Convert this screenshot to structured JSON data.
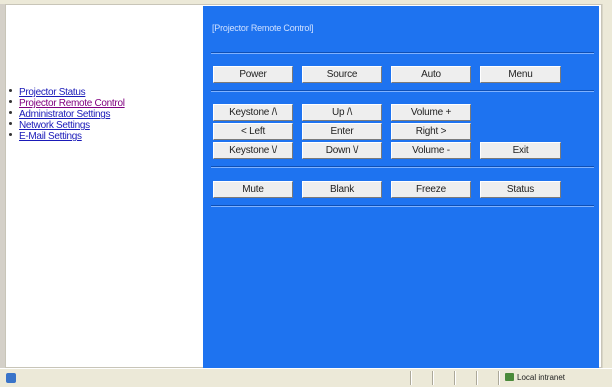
{
  "nav": {
    "items": [
      {
        "label": "Projector Status"
      },
      {
        "label": "Projector Remote Control"
      },
      {
        "label": "Administrator Settings"
      },
      {
        "label": "Network Settings"
      },
      {
        "label": "E-Mail Settings"
      }
    ]
  },
  "content": {
    "title": "[Projector Remote Control]",
    "buttons": {
      "power": "Power",
      "source": "Source",
      "auto": "Auto",
      "menu": "Menu",
      "keystone_up": "Keystone /\\",
      "up": "Up  /\\",
      "volume_up": "Volume +",
      "left": "<  Left",
      "enter": "Enter",
      "right": "Right  >",
      "keystone_down": "Keystone \\/",
      "down": "Down \\/",
      "volume_down": "Volume -",
      "exit": "Exit",
      "mute": "Mute",
      "blank": "Blank",
      "freeze": "Freeze",
      "status": "Status"
    }
  },
  "statusbar": {
    "zone": "Local intranet"
  },
  "colors": {
    "panel": "#1e73f0",
    "link": "#1a1ab8",
    "visited_link": "#800080"
  }
}
